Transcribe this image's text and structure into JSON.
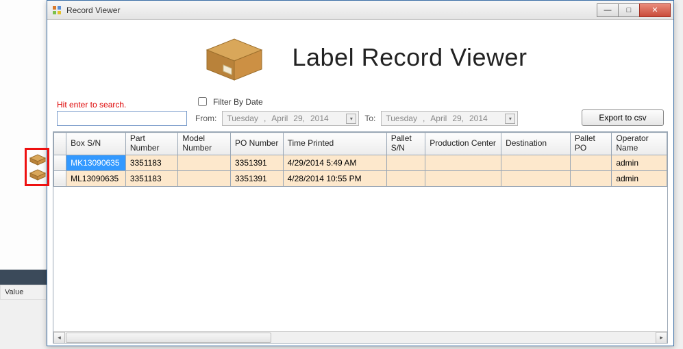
{
  "bg": {
    "value_label": "Value"
  },
  "window": {
    "title": "Record Viewer"
  },
  "hero": {
    "title": "Label Record Viewer"
  },
  "search": {
    "label": "Hit enter to search.",
    "value": ""
  },
  "filter": {
    "checkbox_label": "Filter By Date",
    "from_label": "From:",
    "to_label": "To:",
    "from_date": {
      "weekday": "Tuesday",
      "month": "April",
      "day": "29,",
      "year": "2014"
    },
    "to_date": {
      "weekday": "Tuesday",
      "month": "April",
      "day": "29,",
      "year": "2014"
    }
  },
  "export_label": "Export to csv",
  "grid": {
    "columns": [
      "Box S/N",
      "Part Number",
      "Model Number",
      "PO Number",
      "Time Printed",
      "Pallet S/N",
      "Production Center",
      "Destination",
      "Pallet PO",
      "Operator Name"
    ],
    "rows": [
      {
        "box_sn": "MK13090635",
        "part": "3351183",
        "model": "",
        "po": "3351391",
        "time": "4/29/2014 5:49 AM",
        "pallet_sn": "",
        "center": "",
        "dest": "",
        "pallet_po": "",
        "operator": "admin",
        "selected": true
      },
      {
        "box_sn": "ML13090635",
        "part": "3351183",
        "model": "",
        "po": "3351391",
        "time": "4/28/2014 10:55 PM",
        "pallet_sn": "",
        "center": "",
        "dest": "",
        "pallet_po": "",
        "operator": "admin",
        "selected": false
      }
    ]
  }
}
